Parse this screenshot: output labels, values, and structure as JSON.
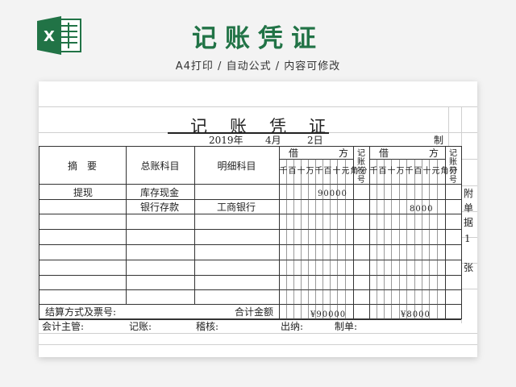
{
  "header": {
    "title": "记账凭证",
    "subtitle": "A4打印 / 自动公式 / 内容可修改",
    "logo_letter": "X",
    "logo_color": "#217346",
    "logo_icon": "excel-icon"
  },
  "voucher": {
    "title_chars": [
      "记",
      "账",
      "凭",
      "证"
    ],
    "date_year": "2019年",
    "date_month": "4月",
    "date_day": "2日",
    "prepared_label": "制",
    "col_summary": "摘　要",
    "col_general_account": "总账科目",
    "col_detail_account": "明细科目",
    "debit_label": [
      "借",
      "方"
    ],
    "credit_label": [
      "借",
      "方"
    ],
    "posted_label": "记账符号",
    "digit_headers": [
      "千",
      "百",
      "十",
      "万",
      "千",
      "百",
      "十",
      "元",
      "角",
      "分"
    ],
    "rows": [
      {
        "summary": "提现",
        "general": "库存现金",
        "detail": "",
        "debit": "90000",
        "credit": ""
      },
      {
        "summary": "",
        "general": "银行存款",
        "detail": "工商银行",
        "debit": "",
        "credit": "8000"
      }
    ],
    "footer_settlement": "结算方式及票号:",
    "footer_total_label": "合计金额",
    "total_debit": "¥90000",
    "total_credit": "¥8000",
    "sign_accountant": "会计主管:",
    "sign_bookkeeper": "记账:",
    "sign_audit": "稽核:",
    "sign_cashier": "出纳:",
    "sign_preparer": "制单:",
    "side_attach": [
      "附",
      "单",
      "据",
      "1",
      "张"
    ]
  }
}
